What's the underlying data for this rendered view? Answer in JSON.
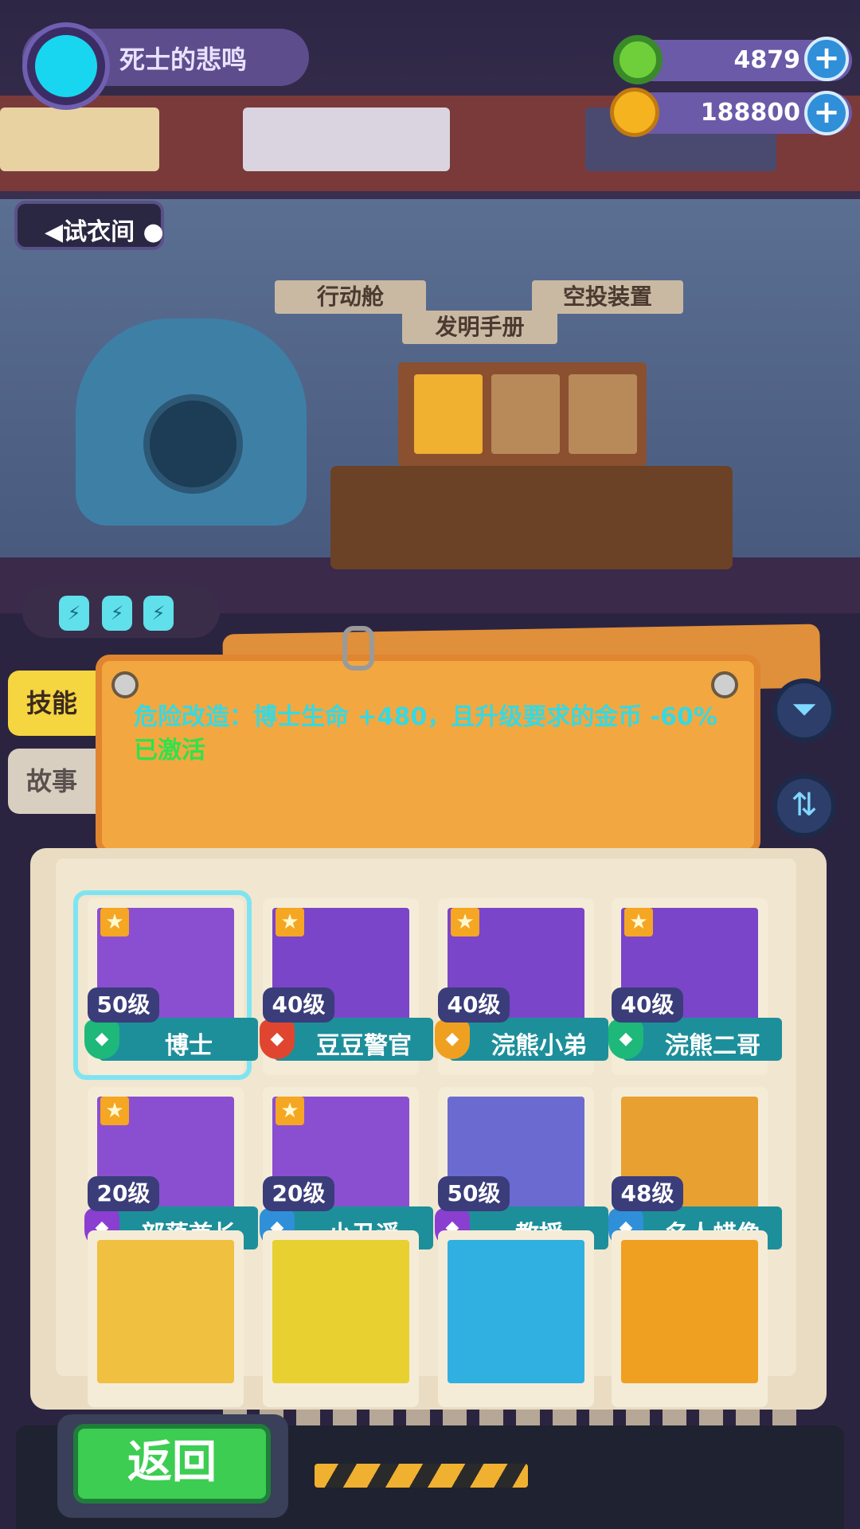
{
  "player": {
    "name": "死士的悲鸣"
  },
  "resources": {
    "gems": {
      "value": "4879",
      "icon": "green-donut-icon",
      "plus": "+"
    },
    "coins": {
      "value": "188800",
      "icon": "planet-coin-icon",
      "plus": "+"
    }
  },
  "fitting_room": {
    "label": "◀试衣间 ●"
  },
  "room_signs": {
    "left": "行动舱",
    "center": "发明手册",
    "right": "空投装置"
  },
  "energy": {
    "cells": [
      "⚡",
      "⚡",
      "⚡"
    ]
  },
  "side_tabs": {
    "skill": "技能",
    "story": "故事"
  },
  "skill_panel": {
    "description": "危险改造：博士生命 +480，且升级要求的金币 -60% ",
    "status": "已激活"
  },
  "tool_buttons": {
    "filter": "⏷",
    "sort": "⇅"
  },
  "characters": [
    {
      "name": "博士",
      "level": "50级",
      "star": true,
      "rarity_color": "#1db87a",
      "bg": "#8a4fd0"
    },
    {
      "name": "豆豆警官",
      "level": "40级",
      "star": true,
      "rarity_color": "#e0462f",
      "bg": "#7a45c8"
    },
    {
      "name": "浣熊小弟",
      "level": "40级",
      "star": true,
      "rarity_color": "#f0a020",
      "bg": "#7a45c8"
    },
    {
      "name": "浣熊二哥",
      "level": "40级",
      "star": true,
      "rarity_color": "#1db87a",
      "bg": "#7a45c8"
    },
    {
      "name": "部落酋长",
      "level": "20级",
      "star": true,
      "rarity_color": "#8a3fd0",
      "bg": "#8a4fd0"
    },
    {
      "name": "小丑遥",
      "level": "20级",
      "star": true,
      "rarity_color": "#2f8fd8",
      "bg": "#8a4fd0"
    },
    {
      "name": "教授",
      "level": "50级",
      "star": false,
      "rarity_color": "#8a3fd0",
      "bg": "#6a6ad0"
    },
    {
      "name": "名人蜡像",
      "level": "48级",
      "star": false,
      "rarity_color": "#2f8fd8",
      "bg": "#e8a030"
    }
  ],
  "back_button": {
    "label": "返回"
  }
}
